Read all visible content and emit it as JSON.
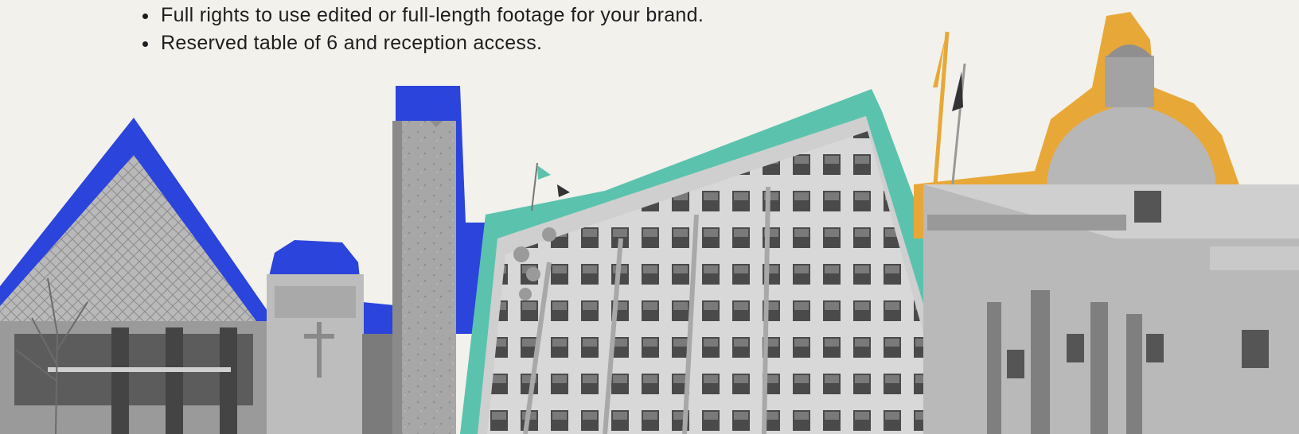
{
  "benefits": [
    "Full rights to use edited or full-length footage for your brand.",
    "Reserved table of 6 and reception access."
  ],
  "colors": {
    "background": "#f2f1ec",
    "pyramid_backdrop": "#2b44db",
    "tower_backdrop": "#2b44db",
    "office_outline": "#5bc3ad",
    "dome_backdrop": "#e8a837"
  },
  "collage": {
    "elements": [
      "city-hall-pyramid",
      "cenotaph-monument",
      "concrete-tower",
      "office-building",
      "legislature-building"
    ]
  }
}
